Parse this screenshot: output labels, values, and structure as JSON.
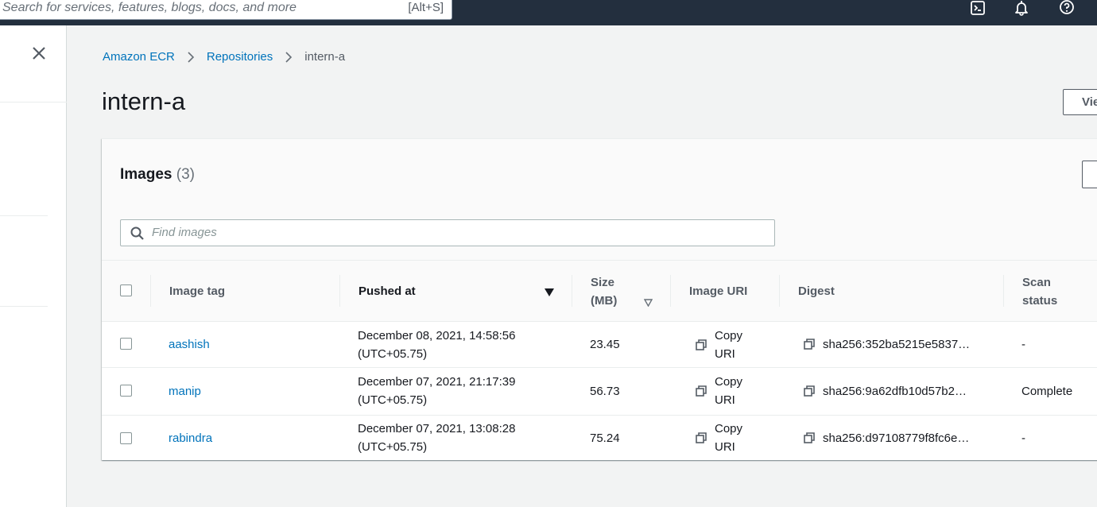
{
  "topbar": {
    "search_placeholder": "Search for services, features, blogs, docs, and more",
    "search_shortcut": "[Alt+S]",
    "icons": [
      "cloudshell-icon",
      "notifications-icon",
      "help-icon"
    ]
  },
  "breadcrumb": {
    "items": [
      "Amazon ECR",
      "Repositories",
      "intern-a"
    ]
  },
  "page": {
    "title": "intern-a",
    "view_button": "Vie"
  },
  "images_panel": {
    "title": "Images",
    "count": "(3)",
    "search_placeholder": "Find images"
  },
  "table": {
    "columns": {
      "image_tag": "Image tag",
      "pushed_at": "Pushed at",
      "size_line1": "Size",
      "size_line2": "(MB)",
      "image_uri": "Image URI",
      "digest": "Digest",
      "scan_line1": "Scan",
      "scan_line2": "status"
    },
    "sorted_column": "Pushed at",
    "sort_direction": "descending",
    "rows": [
      {
        "tag": "aashish",
        "pushed_date": "December 08, 2021, 14:58:56",
        "pushed_tz": "(UTC+05.75)",
        "size": "23.45",
        "uri_line1": "Copy",
        "uri_line2": "URI",
        "digest": "sha256:352ba5215e5837…",
        "scan_status": "-"
      },
      {
        "tag": "manip",
        "pushed_date": "December 07, 2021, 21:17:39",
        "pushed_tz": "(UTC+05.75)",
        "size": "56.73",
        "uri_line1": "Copy",
        "uri_line2": "URI",
        "digest": "sha256:9a62dfb10d57b2…",
        "scan_status": "Complete"
      },
      {
        "tag": "rabindra",
        "pushed_date": "December 07, 2021, 13:08:28",
        "pushed_tz": "(UTC+05.75)",
        "size": "75.24",
        "uri_line1": "Copy",
        "uri_line2": "URI",
        "digest": "sha256:d97108779f8fc6e…",
        "scan_status": "-"
      }
    ]
  },
  "colors": {
    "topbar": "#232f3e",
    "link": "#0073bb",
    "text": "#16191f",
    "muted": "#545b64",
    "background": "#f2f3f3"
  }
}
